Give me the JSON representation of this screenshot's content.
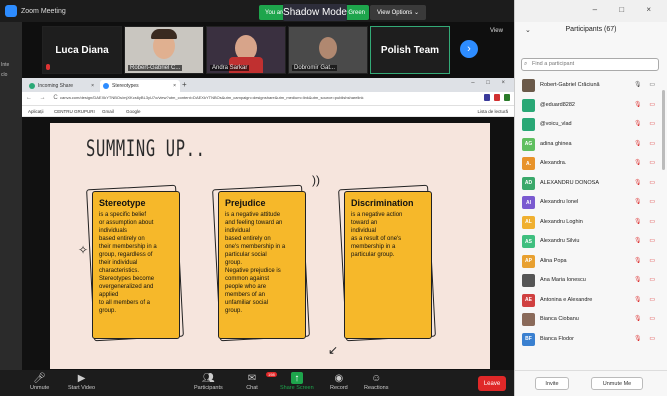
{
  "zoom": {
    "title": "Zoom Meeting",
    "green_left": "You are",
    "green_right": "Green",
    "shadow_mode": "Shadow Mode",
    "view_options": "View Options ⌄"
  },
  "strip": {
    "tiles": [
      {
        "name": "Luca Diana"
      },
      {
        "label": "Robert-Gabriel C..."
      },
      {
        "label": "Andra Sarkar"
      },
      {
        "label": "Dobromir Gat..."
      },
      {
        "name": "Polish Team"
      }
    ],
    "view": "View"
  },
  "left_bleed": [
    "Inte",
    "clo"
  ],
  "browser": {
    "tabs": [
      {
        "title": "Incoming Share"
      },
      {
        "title": "Stereotypes"
      }
    ],
    "url": "canva.com/design/DAEXkYTNBOs/mjXKcs6yBL3yU7o/view?utm_content=DAEXkYTNBOs&utm_campaign=designshare&utm_medium=link&utm_source=publishsharelink",
    "bookmarks": [
      "Aplicații",
      "CENTRU GRUPURI",
      "Gmail",
      "Google"
    ],
    "reading_list": "Lista de lectură"
  },
  "slide": {
    "title": "SUMMING UP..",
    "cards": [
      {
        "heading": "Stereotype",
        "body": "is a specific belief\nor assumption about\nindividuals\nbased entirely on\ntheir membership in a\ngroup, regardless of\ntheir individual\ncharacteristics.\nStereotypes become\novergeneralized and\napplied\nto all members of a\ngroup."
      },
      {
        "heading": "Prejudice",
        "body": "is a negative attitude\nand feeling toward an\nindividual\nbased entirely on\none's membership in a\nparticular social\ngroup.\nNegative prejudice is\ncommon against\npeople who are\nmembers of an\nunfamiliar social\ngroup."
      },
      {
        "heading": "Discrimination",
        "body": "is a negative action\ntoward an\nindividual\nas a result of one's\nmembership in a\nparticular group."
      }
    ]
  },
  "toolbar": {
    "unmute": "Unmute",
    "start_video": "Start Video",
    "participants": "Participants",
    "participants_count": "67",
    "chat": "Chat",
    "chat_badge": "198",
    "share": "Share Screen",
    "record": "Record",
    "reactions": "Reactions",
    "leave": "Leave"
  },
  "panel": {
    "title": "Participants (67)",
    "search_placeholder": "Find a participant",
    "participants": [
      {
        "name": "Robert-Gabriel Crăciună",
        "initials": "",
        "color": "#6b5a4a",
        "muted": false
      },
      {
        "name": "@eduard8282",
        "initials": "",
        "color": "#2aa876",
        "muted": true
      },
      {
        "name": "@voicu_vlad",
        "initials": "",
        "color": "#2aa876",
        "muted": true
      },
      {
        "name": "adina ghinea",
        "initials": "AG",
        "color": "#5fbf5f",
        "muted": true
      },
      {
        "name": "Alexandra.",
        "initials": "A.",
        "color": "#e8932a",
        "muted": true
      },
      {
        "name": "ALEXANDRU DONOSA",
        "initials": "AD",
        "color": "#3aa86a",
        "muted": true
      },
      {
        "name": "Alexandru Ionel",
        "initials": "AI",
        "color": "#7a5ad0",
        "muted": true
      },
      {
        "name": "Alexandru Loghin",
        "initials": "AL",
        "color": "#f0b030",
        "muted": true
      },
      {
        "name": "Alexandru Silviu",
        "initials": "AS",
        "color": "#3fbf7f",
        "muted": true
      },
      {
        "name": "Alina Popa",
        "initials": "AP",
        "color": "#e8a030",
        "muted": true
      },
      {
        "name": "Ana Maria Ionescu",
        "initials": "",
        "color": "#555555",
        "muted": true
      },
      {
        "name": "Antonina e Alexandre",
        "initials": "AE",
        "color": "#d04040",
        "muted": true
      },
      {
        "name": "Bianca Ciobanu",
        "initials": "",
        "color": "#8a6a5a",
        "muted": true
      },
      {
        "name": "Bianca Flodor",
        "initials": "BF",
        "color": "#3a80d0",
        "muted": true
      }
    ],
    "invite": "Invite",
    "unmute_me": "Unmute Me"
  }
}
